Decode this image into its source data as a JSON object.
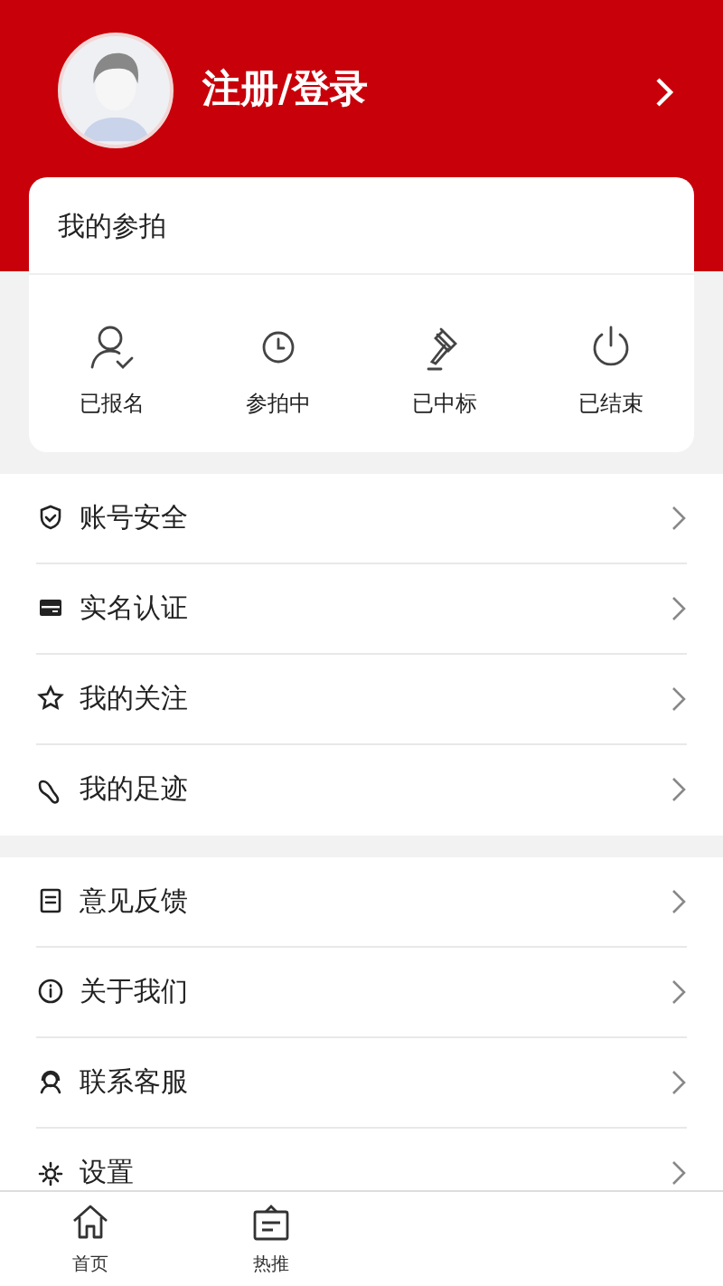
{
  "profile": {
    "login_label": "注册/登录"
  },
  "auction_card": {
    "title": "我的参拍",
    "items": [
      {
        "kind": "registered",
        "label": "已报名"
      },
      {
        "kind": "bidding",
        "label": "参拍中"
      },
      {
        "kind": "won",
        "label": "已中标"
      },
      {
        "kind": "ended",
        "label": "已结束"
      }
    ]
  },
  "menu_groups": [
    [
      {
        "kind": "shield",
        "label": "账号安全"
      },
      {
        "kind": "card",
        "label": "实名认证"
      },
      {
        "kind": "star",
        "label": "我的关注"
      },
      {
        "kind": "footprint",
        "label": "我的足迹"
      }
    ],
    [
      {
        "kind": "feedback",
        "label": "意见反馈"
      },
      {
        "kind": "info",
        "label": "关于我们"
      },
      {
        "kind": "service",
        "label": "联系客服"
      },
      {
        "kind": "settings",
        "label": "设置"
      }
    ]
  ],
  "tab_bar": [
    {
      "kind": "home",
      "label": "首页",
      "selected": false
    },
    {
      "kind": "hot",
      "label": "热推",
      "selected": false
    }
  ]
}
